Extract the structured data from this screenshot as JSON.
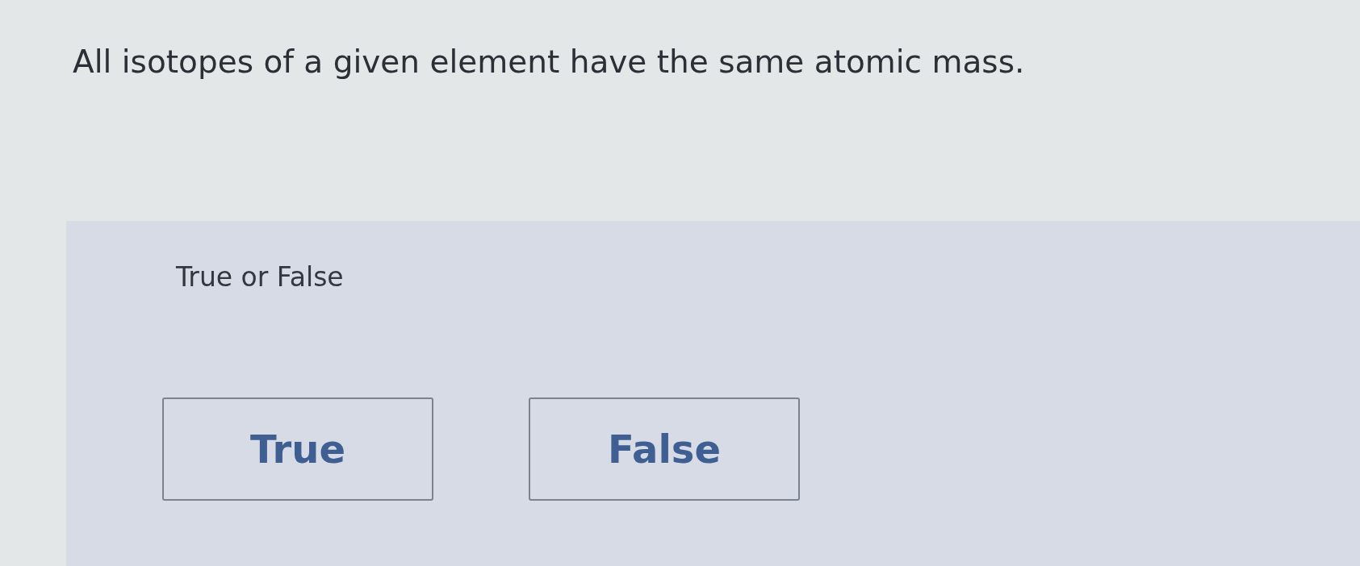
{
  "question": "All isotopes of a given element have the same atomic mass.",
  "answer_panel": {
    "prompt": "True or False",
    "options": [
      {
        "label": "True",
        "selected": false
      },
      {
        "label": "False",
        "selected": false
      }
    ]
  }
}
